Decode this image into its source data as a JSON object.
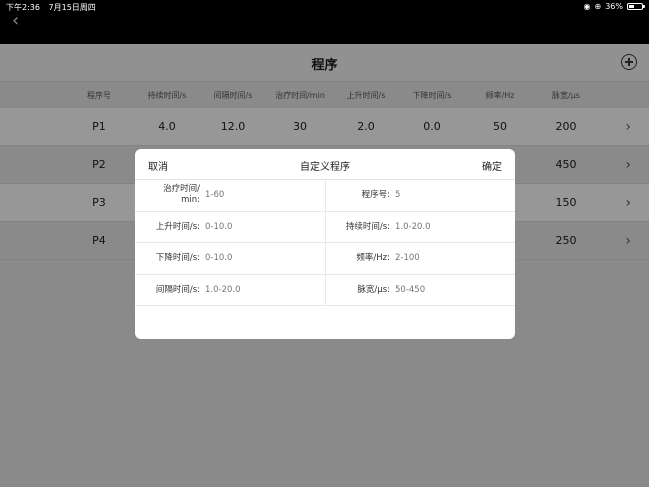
{
  "status_bar": {
    "time": "下午2:36",
    "date": "7月15日周四",
    "battery": "36%",
    "battery_level": 0.36
  },
  "nav": {
    "title": "程序"
  },
  "table": {
    "headers": [
      "程序号",
      "持续时间/s",
      "间隔时间/s",
      "治疗时间/min",
      "上升时间/s",
      "下降时间/s",
      "频率/Hz",
      "脉宽/µs"
    ],
    "rows": [
      [
        "P1",
        "4.0",
        "12.0",
        "30",
        "2.0",
        "0.0",
        "50",
        "200"
      ],
      [
        "P2",
        "",
        "",
        "",
        "",
        "",
        "",
        "450"
      ],
      [
        "P3",
        "",
        "",
        "",
        "",
        "",
        "",
        "150"
      ],
      [
        "P4",
        "",
        "",
        "",
        "",
        "",
        "",
        "250"
      ]
    ]
  },
  "modal": {
    "cancel": "取消",
    "title": "自定义程序",
    "confirm": "确定",
    "fields": {
      "treatment_time": {
        "label_1": "治疗时间/",
        "label_2": "min:",
        "placeholder": "1-60"
      },
      "program_no": {
        "label": "程序号:",
        "value": "5"
      },
      "rise_time": {
        "label": "上升时间/s:",
        "placeholder": "0-10.0"
      },
      "duration": {
        "label": "持续时间/s:",
        "placeholder": "1.0-20.0"
      },
      "fall_time": {
        "label": "下降时间/s:",
        "placeholder": "0-10.0"
      },
      "frequency": {
        "label": "频率/Hz:",
        "placeholder": "2-100"
      },
      "interval": {
        "label": "间隔时间/s:",
        "placeholder": "1.0-20.0"
      },
      "pulse_width": {
        "label": "脉宽/µs:",
        "placeholder": "50-450"
      }
    }
  }
}
